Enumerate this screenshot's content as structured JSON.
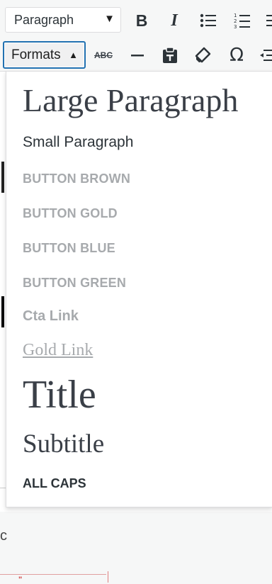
{
  "toolbar": {
    "block_format": {
      "value": "Paragraph",
      "icon": "chevron-down-icon"
    },
    "row1_buttons": [
      {
        "name": "bold",
        "icon": "bold-icon",
        "glyph": "B"
      },
      {
        "name": "italic",
        "icon": "italic-icon",
        "glyph": "I"
      },
      {
        "name": "bulleted-list",
        "icon": "bulleted-list-icon"
      },
      {
        "name": "numbered-list",
        "icon": "numbered-list-icon"
      }
    ],
    "formats_button": {
      "label": "Formats",
      "icon": "caret-up-icon",
      "active": true,
      "border_color": "#2271b1"
    },
    "row2_buttons": [
      {
        "name": "strikethrough",
        "icon": "strikethrough-icon",
        "glyph": "ABC"
      },
      {
        "name": "horizontal-line",
        "icon": "horizontal-line-icon"
      },
      {
        "name": "paste-as-text",
        "icon": "paste-text-icon"
      },
      {
        "name": "clear-formatting",
        "icon": "eraser-icon"
      },
      {
        "name": "special-character",
        "icon": "omega-icon",
        "glyph": "Ω"
      },
      {
        "name": "outdent",
        "icon": "outdent-icon"
      }
    ]
  },
  "formats_menu": {
    "items": [
      {
        "label": "Large Paragraph"
      },
      {
        "label": "Small Paragraph"
      },
      {
        "label": "BUTTON BROWN"
      },
      {
        "label": "BUTTON GOLD"
      },
      {
        "label": "BUTTON BLUE"
      },
      {
        "label": "BUTTON GREEN"
      },
      {
        "label": "Cta Link"
      },
      {
        "label": "Gold Link"
      },
      {
        "label": "Title"
      },
      {
        "label": "Subtitle"
      },
      {
        "label": "ALL CAPS"
      }
    ]
  },
  "background": {
    "fragment_text": "c",
    "fragment_mark": "\""
  },
  "colors": {
    "accent": "#2271b1",
    "muted_item": "#a7aaad",
    "heading_item": "#3a3f47"
  }
}
